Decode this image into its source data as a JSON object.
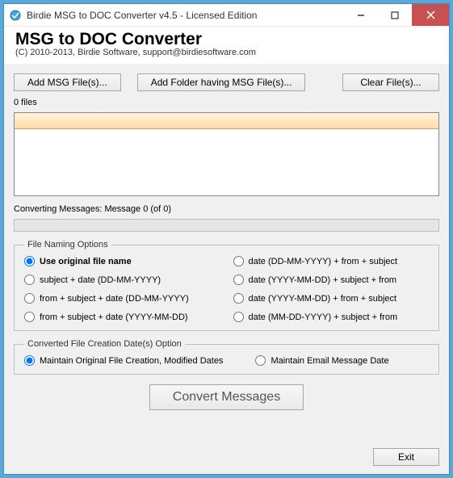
{
  "window": {
    "title": "Birdie MSG to DOC Converter v4.5 - Licensed Edition"
  },
  "header": {
    "main_title": "MSG to DOC Converter",
    "copyright": "(C) 2010-2013, Birdie Software, support@birdiesoftware.com"
  },
  "toolbar": {
    "add_files": "Add MSG File(s)...",
    "add_folder": "Add Folder having MSG File(s)...",
    "clear_files": "Clear File(s)..."
  },
  "files": {
    "count_label": "0 files"
  },
  "progress": {
    "label_prefix": "Converting Messages:",
    "status": "Message 0 (of 0)"
  },
  "naming": {
    "legend": "File Naming Options",
    "options": [
      "Use original file name",
      "date (DD-MM-YYYY) + from + subject",
      "subject + date (DD-MM-YYYY)",
      "date (YYYY-MM-DD) + subject + from",
      "from + subject + date (DD-MM-YYYY)",
      "date (YYYY-MM-DD) + from + subject",
      "from + subject + date (YYYY-MM-DD)",
      "date (MM-DD-YYYY) + subject + from"
    ]
  },
  "dates": {
    "legend": "Converted File Creation Date(s) Option",
    "maintain_original": "Maintain Original File Creation, Modified Dates",
    "maintain_email": "Maintain Email Message Date"
  },
  "actions": {
    "convert": "Convert Messages",
    "exit": "Exit"
  }
}
